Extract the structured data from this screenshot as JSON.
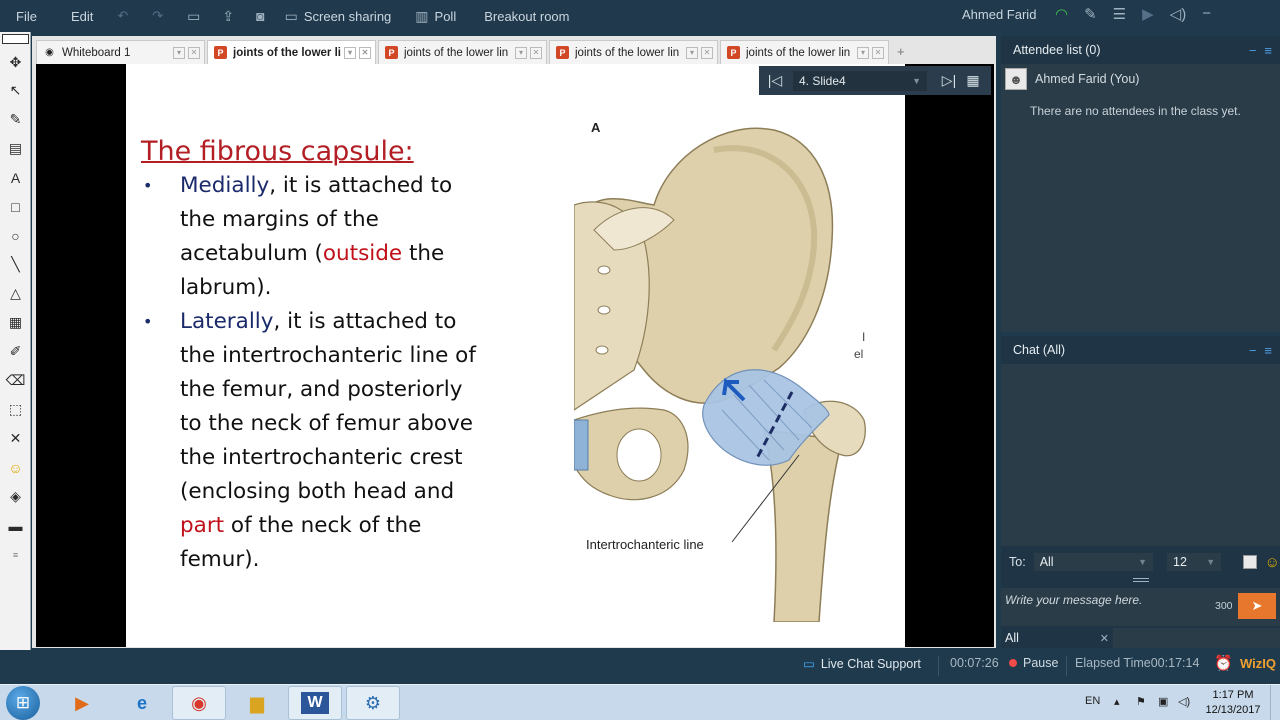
{
  "menubar": {
    "file": "File",
    "edit": "Edit",
    "screen_sharing": "Screen sharing",
    "poll": "Poll",
    "breakout_room": "Breakout room",
    "user_name": "Ahmed Farid"
  },
  "tabs": [
    {
      "label": "Whiteboard 1",
      "icon": "eye-icon"
    },
    {
      "label": "joints of the lower lin",
      "icon": "powerpoint-icon"
    },
    {
      "label": "joints of the lower lin",
      "icon": "powerpoint-icon"
    },
    {
      "label": "joints of the lower lin",
      "icon": "powerpoint-icon"
    },
    {
      "label": "joints of the lower lin",
      "icon": "powerpoint-icon"
    }
  ],
  "slide_nav": {
    "current": "4. Slide4"
  },
  "slide": {
    "title": "The fibrous capsule:",
    "b1": {
      "medially": "Medially",
      "line1_rest": ", it is attached to",
      "line2": "the margins of the",
      "acetabulum": "acetabulum (",
      "outside": "outside",
      "the": " the",
      "line4": "labrum)."
    },
    "b2": {
      "laterally": "Laterally",
      "line1_rest": ", it is attached to",
      "line2": "the intertrochanteric line of",
      "line3": "the femur, and posteriorly",
      "line4": "to the neck of femur above",
      "line5": "the intertrochanteric crest",
      "line6": "(enclosing both head and",
      "part": "part",
      "line7_rest": " of the neck of the",
      "line8": "femur)."
    },
    "figure": {
      "letter": "A",
      "label": "Intertrochanteric line",
      "partial_label": "el",
      "partial_mark": "I"
    }
  },
  "attendee": {
    "title": "Attendee list (0)",
    "me": "Ahmed Farid (You)",
    "empty": "There are no attendees in the class yet."
  },
  "chat": {
    "title": "Chat (All)",
    "to_label": "To:",
    "to_value": "All",
    "font_size": "12",
    "placeholder": "Write your message here.",
    "char_count": "300",
    "tab_all": "All"
  },
  "status": {
    "live_chat": "Live Chat Support",
    "time": "00:07:26",
    "pause": "Pause",
    "elapsed_label": "Elapsed Time",
    "elapsed_value": "00:17:14",
    "brand": "WizIQ"
  },
  "taskbar": {
    "lang": "EN",
    "time": "1:17 PM",
    "date": "12/13/2017"
  },
  "colors": {
    "title_red": "#b21e24",
    "navy": "#1b2a6b",
    "accent_orange": "#e8772e"
  }
}
